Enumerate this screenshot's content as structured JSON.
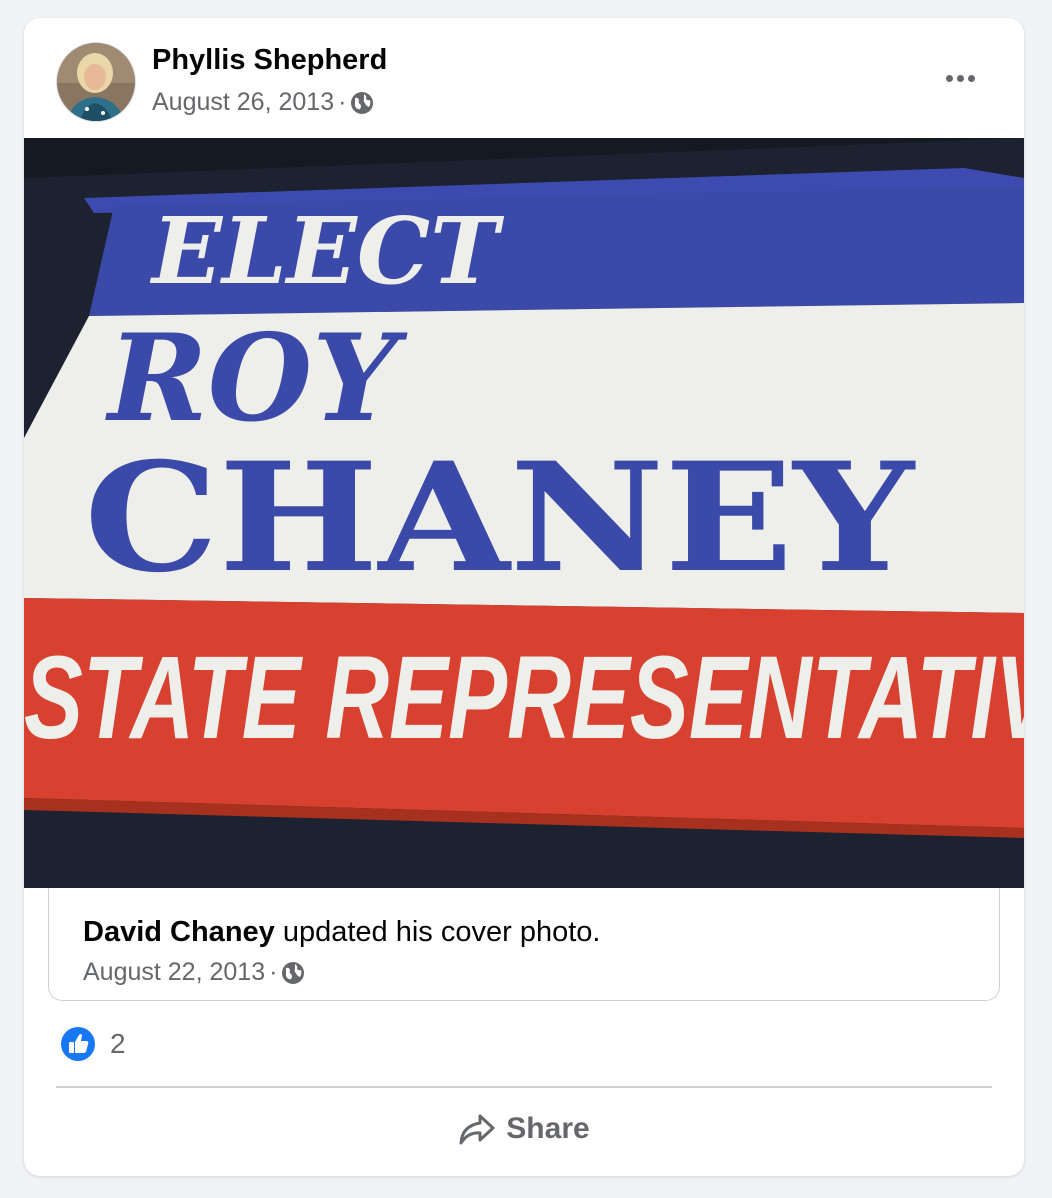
{
  "post": {
    "author": "Phyllis Shepherd",
    "date": "August 26, 2013",
    "separator": "·",
    "privacy_icon": "globe-icon",
    "menu_icon": "more-options-icon"
  },
  "photo": {
    "sign_top": "ELECT",
    "sign_name_1": "ROY",
    "sign_name_2": "CHANEY",
    "sign_bottom": "STATE REPRESENTATIV",
    "colors": {
      "blue": "#3b4aa8",
      "white": "#eeeeea",
      "red": "#d8412f",
      "background": "#151922"
    }
  },
  "shared": {
    "who": "David Chaney",
    "action": " updated his cover photo.",
    "date": "August 22, 2013",
    "separator": "·",
    "privacy_icon": "globe-icon"
  },
  "reactions": {
    "icon": "like-icon",
    "count": "2"
  },
  "actions": {
    "share_label": "Share",
    "share_icon": "share-icon"
  },
  "colors": {
    "page_bg": "#f0f2f5",
    "card_bg": "#ffffff",
    "text_primary": "#050505",
    "text_secondary": "#65676b",
    "like_blue": "#1877f2"
  }
}
